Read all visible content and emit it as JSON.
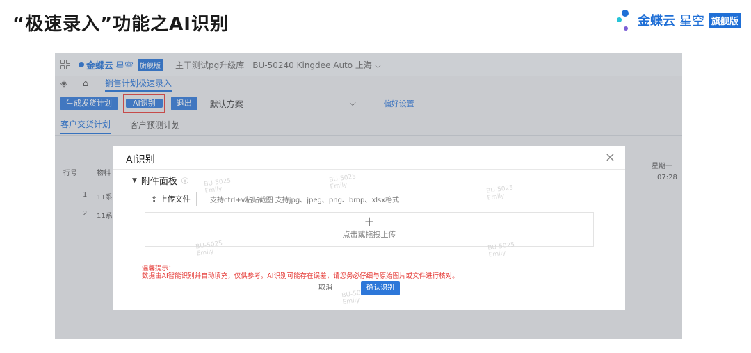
{
  "slide": {
    "title": "“极速录入”功能之AI识别"
  },
  "brand": {
    "name_bold": "金蝶云",
    "name_light": "星空",
    "tag": "旗舰版"
  },
  "app": {
    "topbar": {
      "logo_bold": "金蝶云",
      "logo_light": "星空",
      "logo_tag": "旗舰版",
      "db": "主干测试pg升级库",
      "org": "BU-50240 Kingdee Auto 上海",
      "org_chevron": "⌵"
    },
    "nav": {
      "active_tab": "销售计划极速录入"
    },
    "toolbar": {
      "generate": "生成发货计划",
      "ai": "AI识别",
      "exit": "退出",
      "scheme": "默认方案",
      "scheme_chevron": "⌵",
      "pref": "偏好设置"
    },
    "subtabs": [
      "客户交货计划",
      "客户预测计划"
    ],
    "table": {
      "col_no": "行号",
      "col_material": "物料",
      "col_week": "星期一",
      "col_time": "07:28",
      "rows": [
        {
          "no": "1",
          "material": "11系"
        },
        {
          "no": "2",
          "material": "11系"
        }
      ]
    }
  },
  "modal": {
    "title": "AI识别",
    "close": "×",
    "panel_title": "附件面板",
    "upload_label": "上传文件",
    "upload_hint": "支持ctrl+v粘贴截图    支持jpg、jpeg、png、bmp、xlsx格式",
    "drop_plus": "+",
    "drop_text": "点击或拖拽上传",
    "tip_title": "温馨提示：",
    "tip_body": "数据由AI智能识别并自动填充，仅供参考。AI识别可能存在误差，请您务必仔细与原始图片或文件进行核对。",
    "cancel": "取消",
    "confirm": "确认识别"
  },
  "watermark": {
    "line1": "BU-5025",
    "line2": "Emily"
  },
  "colors": {
    "accent": "#2d77d9",
    "brand": "#1f6fd6",
    "warning": "#e53935"
  }
}
